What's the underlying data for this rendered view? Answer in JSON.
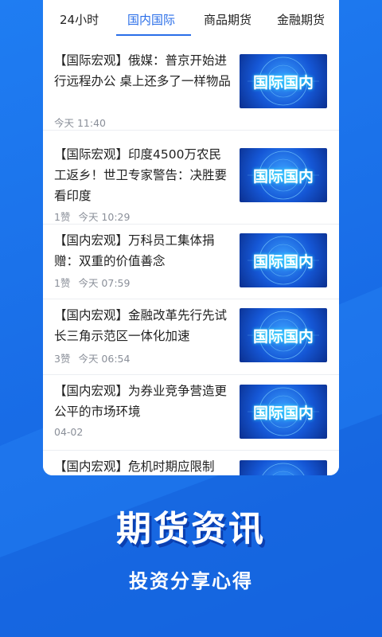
{
  "tabs": [
    {
      "label": "24小时"
    },
    {
      "label": "国内国际"
    },
    {
      "label": "商品期货"
    },
    {
      "label": "金融期货"
    }
  ],
  "active_tab": "国内国际",
  "thumb_text": "国际国内",
  "articles": [
    {
      "title": "【国际宏观】俄媒：普京开始进行远程办公 桌上还多了一样物品",
      "likes": "",
      "time": "今天 11:40"
    },
    {
      "title": "【国际宏观】印度4500万农民工返乡！世卫专家警告：决胜要看印度",
      "likes": "1赞",
      "time": "今天 10:29"
    },
    {
      "title": "【国内宏观】万科员工集体捐赠：双重的价值善念",
      "likes": "1赞",
      "time": "今天 07:59"
    },
    {
      "title": "【国内宏观】金融改革先行先试 长三角示范区一体化加速",
      "likes": "3赞",
      "time": "今天 06:54"
    },
    {
      "title": "【国内宏观】为券业竞争营造更公平的市场环境",
      "likes": "",
      "time": "04-02"
    },
    {
      "title": "【国内宏观】危机时期应限制",
      "likes": "",
      "time": ""
    }
  ],
  "promo": {
    "headline": "期货资讯",
    "subline": "投资分享心得"
  },
  "colors": {
    "accent": "#2a6ee8",
    "background": "#1a6fe8"
  }
}
